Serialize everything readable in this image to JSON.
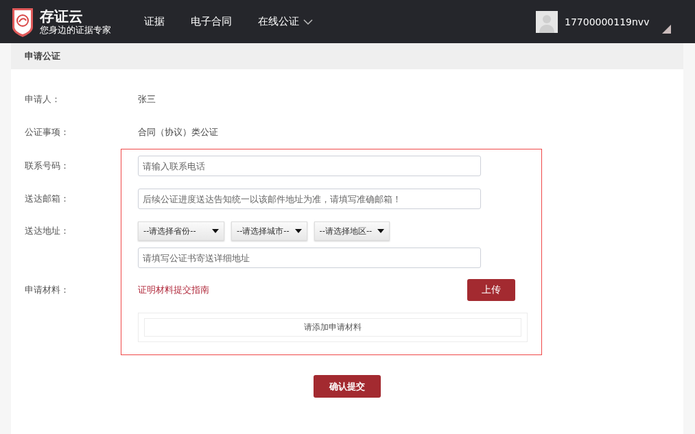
{
  "brand": {
    "name": "存证云",
    "tagline": "您身边的证据专家"
  },
  "nav": [
    {
      "label": "证据",
      "dropdown": false
    },
    {
      "label": "电子合同",
      "dropdown": false
    },
    {
      "label": "在线公证",
      "dropdown": true
    }
  ],
  "user": {
    "name": "17700000119nvv"
  },
  "panel": {
    "title": "申请公证"
  },
  "info_rows": [
    {
      "label": "申请人：",
      "value": "张三"
    },
    {
      "label": "公证事项：",
      "value": "合同（协议）类公证"
    }
  ],
  "phone": {
    "label": "联系号码：",
    "placeholder": "请输入联系电话"
  },
  "email": {
    "label": "送达邮箱：",
    "placeholder": "后续公证进度送达告知统一以该邮件地址为准，请填写准确邮箱！"
  },
  "address": {
    "label": "送达地址：",
    "selects": [
      {
        "value": "--请选择省份--"
      },
      {
        "value": "--请选择城市--"
      },
      {
        "value": "--请选择地区--"
      }
    ],
    "detail_placeholder": "请填写公证书寄送详细地址"
  },
  "materials": {
    "label": "申请材料：",
    "guide_link": "证明材料提交指南",
    "upload_button": "上传",
    "empty_text": "请添加申请材料"
  },
  "submit_button": "确认提交"
}
